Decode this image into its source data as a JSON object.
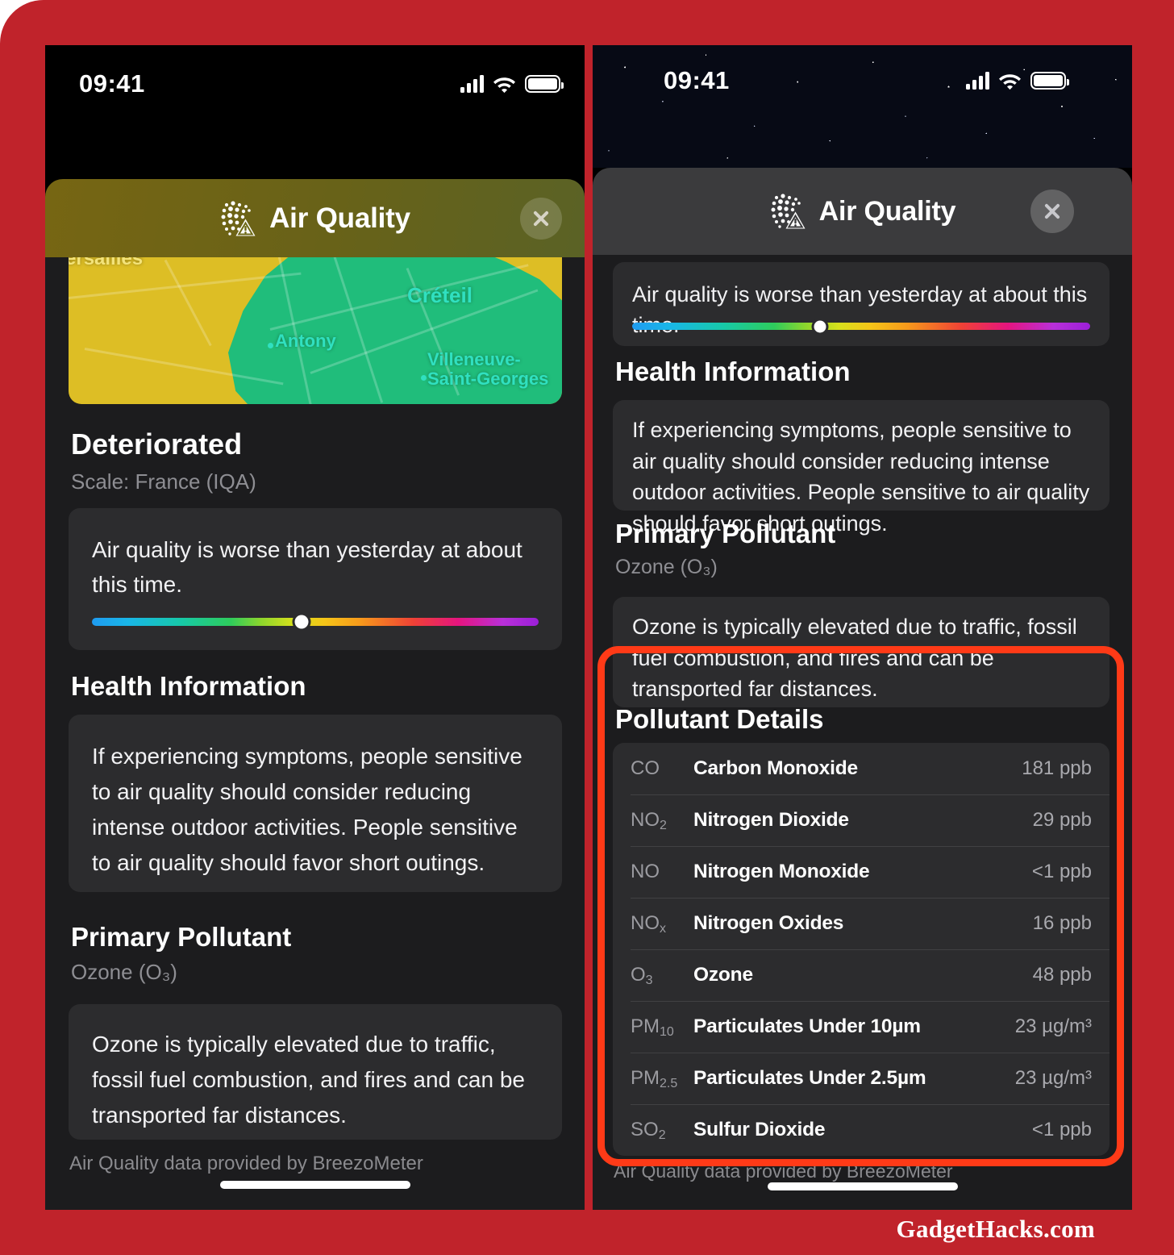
{
  "watermark": "GadgetHacks.com",
  "status_bar": {
    "time": "09:41",
    "icons": [
      "cellular-signal-icon",
      "wifi-icon",
      "battery-icon"
    ]
  },
  "modal": {
    "title": "Air Quality",
    "icon_name": "air-quality-dots-warning-icon",
    "close_label": "close-icon"
  },
  "left_phone": {
    "map": {
      "labels": [
        {
          "text": "ersailles",
          "color": "#f3e37a"
        },
        {
          "text": "Créteil",
          "color": "#30e0c0"
        },
        {
          "text": "Antony",
          "color": "#30e0c0"
        },
        {
          "text": "Villeneuve-",
          "color": "#30e0c0"
        },
        {
          "text": "Saint-Georges",
          "color": "#30e0c0"
        }
      ],
      "region_colors": {
        "moderate": "#ddbe25",
        "good": "#20bd7b"
      }
    },
    "condition": "Deteriorated",
    "scale_label": "Scale: France (IQA)",
    "comparison_text": "Air quality is worse than yesterday at about this time.",
    "scale_marker_percent": 47,
    "health_heading": "Health Information",
    "health_text": "If experiencing symptoms, people sensitive to air quality should consider reducing intense outdoor activities. People sensitive to air quality should favor short outings.",
    "pollutant_heading": "Primary Pollutant",
    "pollutant_sub": "Ozone (O₃)",
    "pollutant_text": "Ozone is typically elevated due to traffic, fossil fuel combustion, and fires and can be transported far distances.",
    "footnote": "Air Quality data provided by BreezoMeter"
  },
  "right_phone": {
    "comparison_text": "Air quality is worse than yesterday at about this time.",
    "scale_marker_percent": 41,
    "health_heading": "Health Information",
    "health_text": "If experiencing symptoms, people sensitive to air quality should consider reducing intense outdoor activities. People sensitive to air quality should favor short outings.",
    "pollutant_heading": "Primary Pollutant",
    "pollutant_sub": "Ozone (O₃)",
    "pollutant_text": "Ozone is typically elevated due to traffic, fossil fuel combustion, and fires and can be transported far distances.",
    "details_heading": "Pollutant Details",
    "pollutants": [
      {
        "formula": "CO",
        "sub": "",
        "name": "Carbon Monoxide",
        "value": "181 ppb"
      },
      {
        "formula": "NO",
        "sub": "2",
        "name": "Nitrogen Dioxide",
        "value": "29 ppb"
      },
      {
        "formula": "NO",
        "sub": "",
        "name": "Nitrogen Monoxide",
        "value": "<1 ppb"
      },
      {
        "formula": "NO",
        "sub": "x",
        "name": "Nitrogen Oxides",
        "value": "16 ppb"
      },
      {
        "formula": "O",
        "sub": "3",
        "name": "Ozone",
        "value": "48 ppb"
      },
      {
        "formula": "PM",
        "sub": "10",
        "name": "Particulates Under 10µm",
        "value": "23 µg/m³"
      },
      {
        "formula": "PM",
        "sub": "2.5",
        "name": "Particulates Under 2.5µm",
        "value": "23 µg/m³"
      },
      {
        "formula": "SO",
        "sub": "2",
        "name": "Sulfur Dioxide",
        "value": "<1 ppb"
      }
    ],
    "footnote": "Air Quality data provided by BreezoMeter",
    "highlight_color": "#ff3a17"
  }
}
